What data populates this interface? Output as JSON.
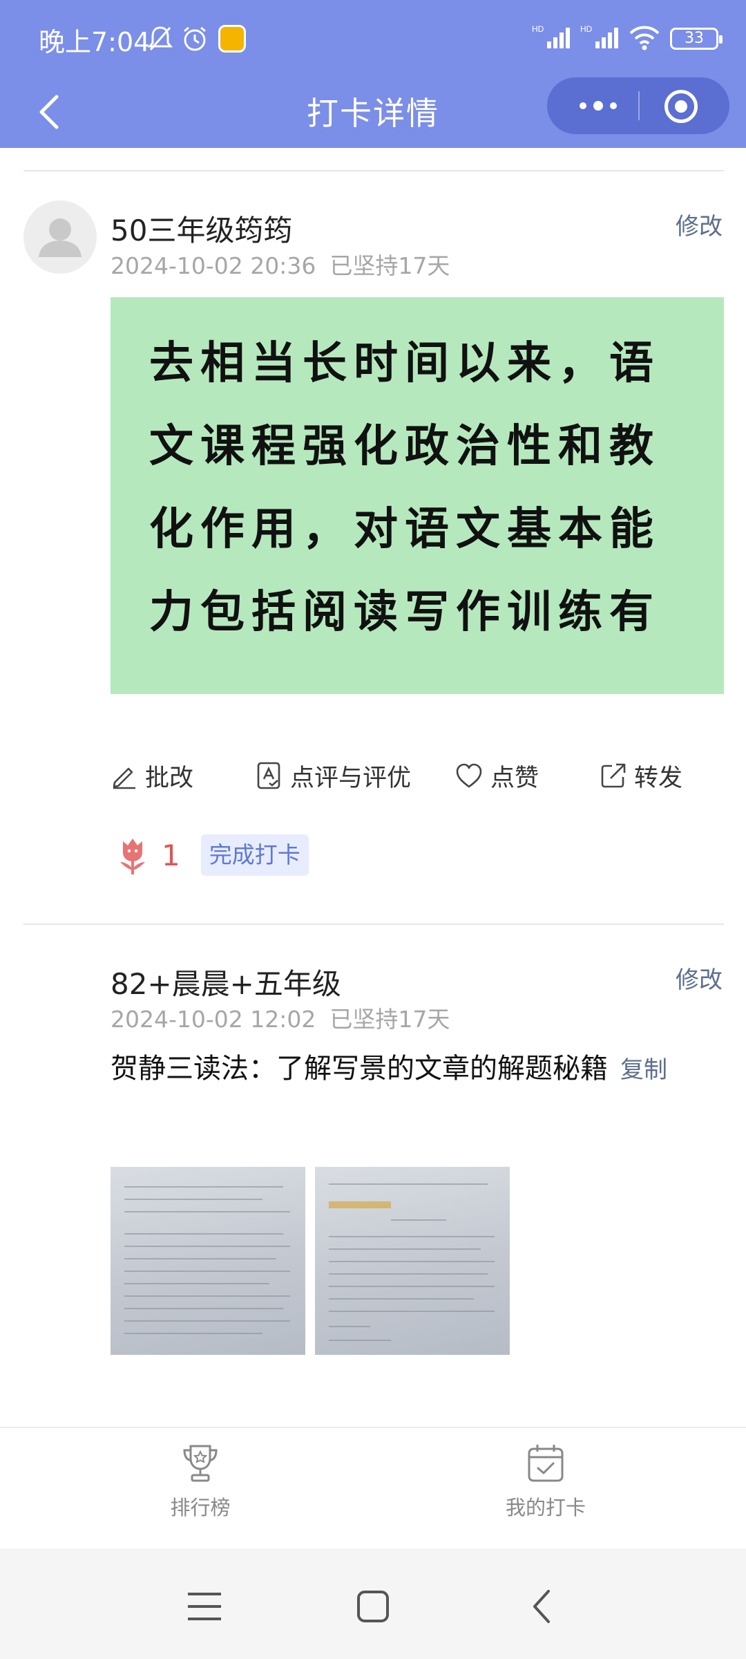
{
  "status_bar": {
    "time": "晚上7:04",
    "signal1": "HD",
    "signal2": "HD",
    "battery": "33"
  },
  "header": {
    "title": "打卡详情"
  },
  "posts": [
    {
      "username": "50三年级筠筠",
      "datetime": "2024-10-02 20:36",
      "streak": "已坚持17天",
      "edit_label": "修改",
      "image_text_lines": [
        "去相当长时间以来，语",
        "文课程强化政治性和教",
        "化作用，对语文基本能",
        "力包括阅读写作训练有"
      ],
      "actions": {
        "correct": "批改",
        "review": "点评与评优",
        "like": "点赞",
        "share": "转发"
      },
      "flower_count": "1",
      "done_tag": "完成打卡"
    },
    {
      "username": "82+晨晨+五年级",
      "datetime": "2024-10-02 12:02",
      "streak": "已坚持17天",
      "edit_label": "修改",
      "text": "贺静三读法：了解写景的文章的解题秘籍",
      "copy_label": "复制"
    }
  ],
  "tabbar": {
    "leaderboard": "排行榜",
    "my_checkin": "我的打卡"
  },
  "colors": {
    "header_bg": "#7b8ee8",
    "link": "#5b6f8e",
    "tag_bg": "#e8ecff",
    "tag_text": "#5d78d8",
    "flower": "#e05555",
    "image_bg": "#b5e9bd"
  }
}
